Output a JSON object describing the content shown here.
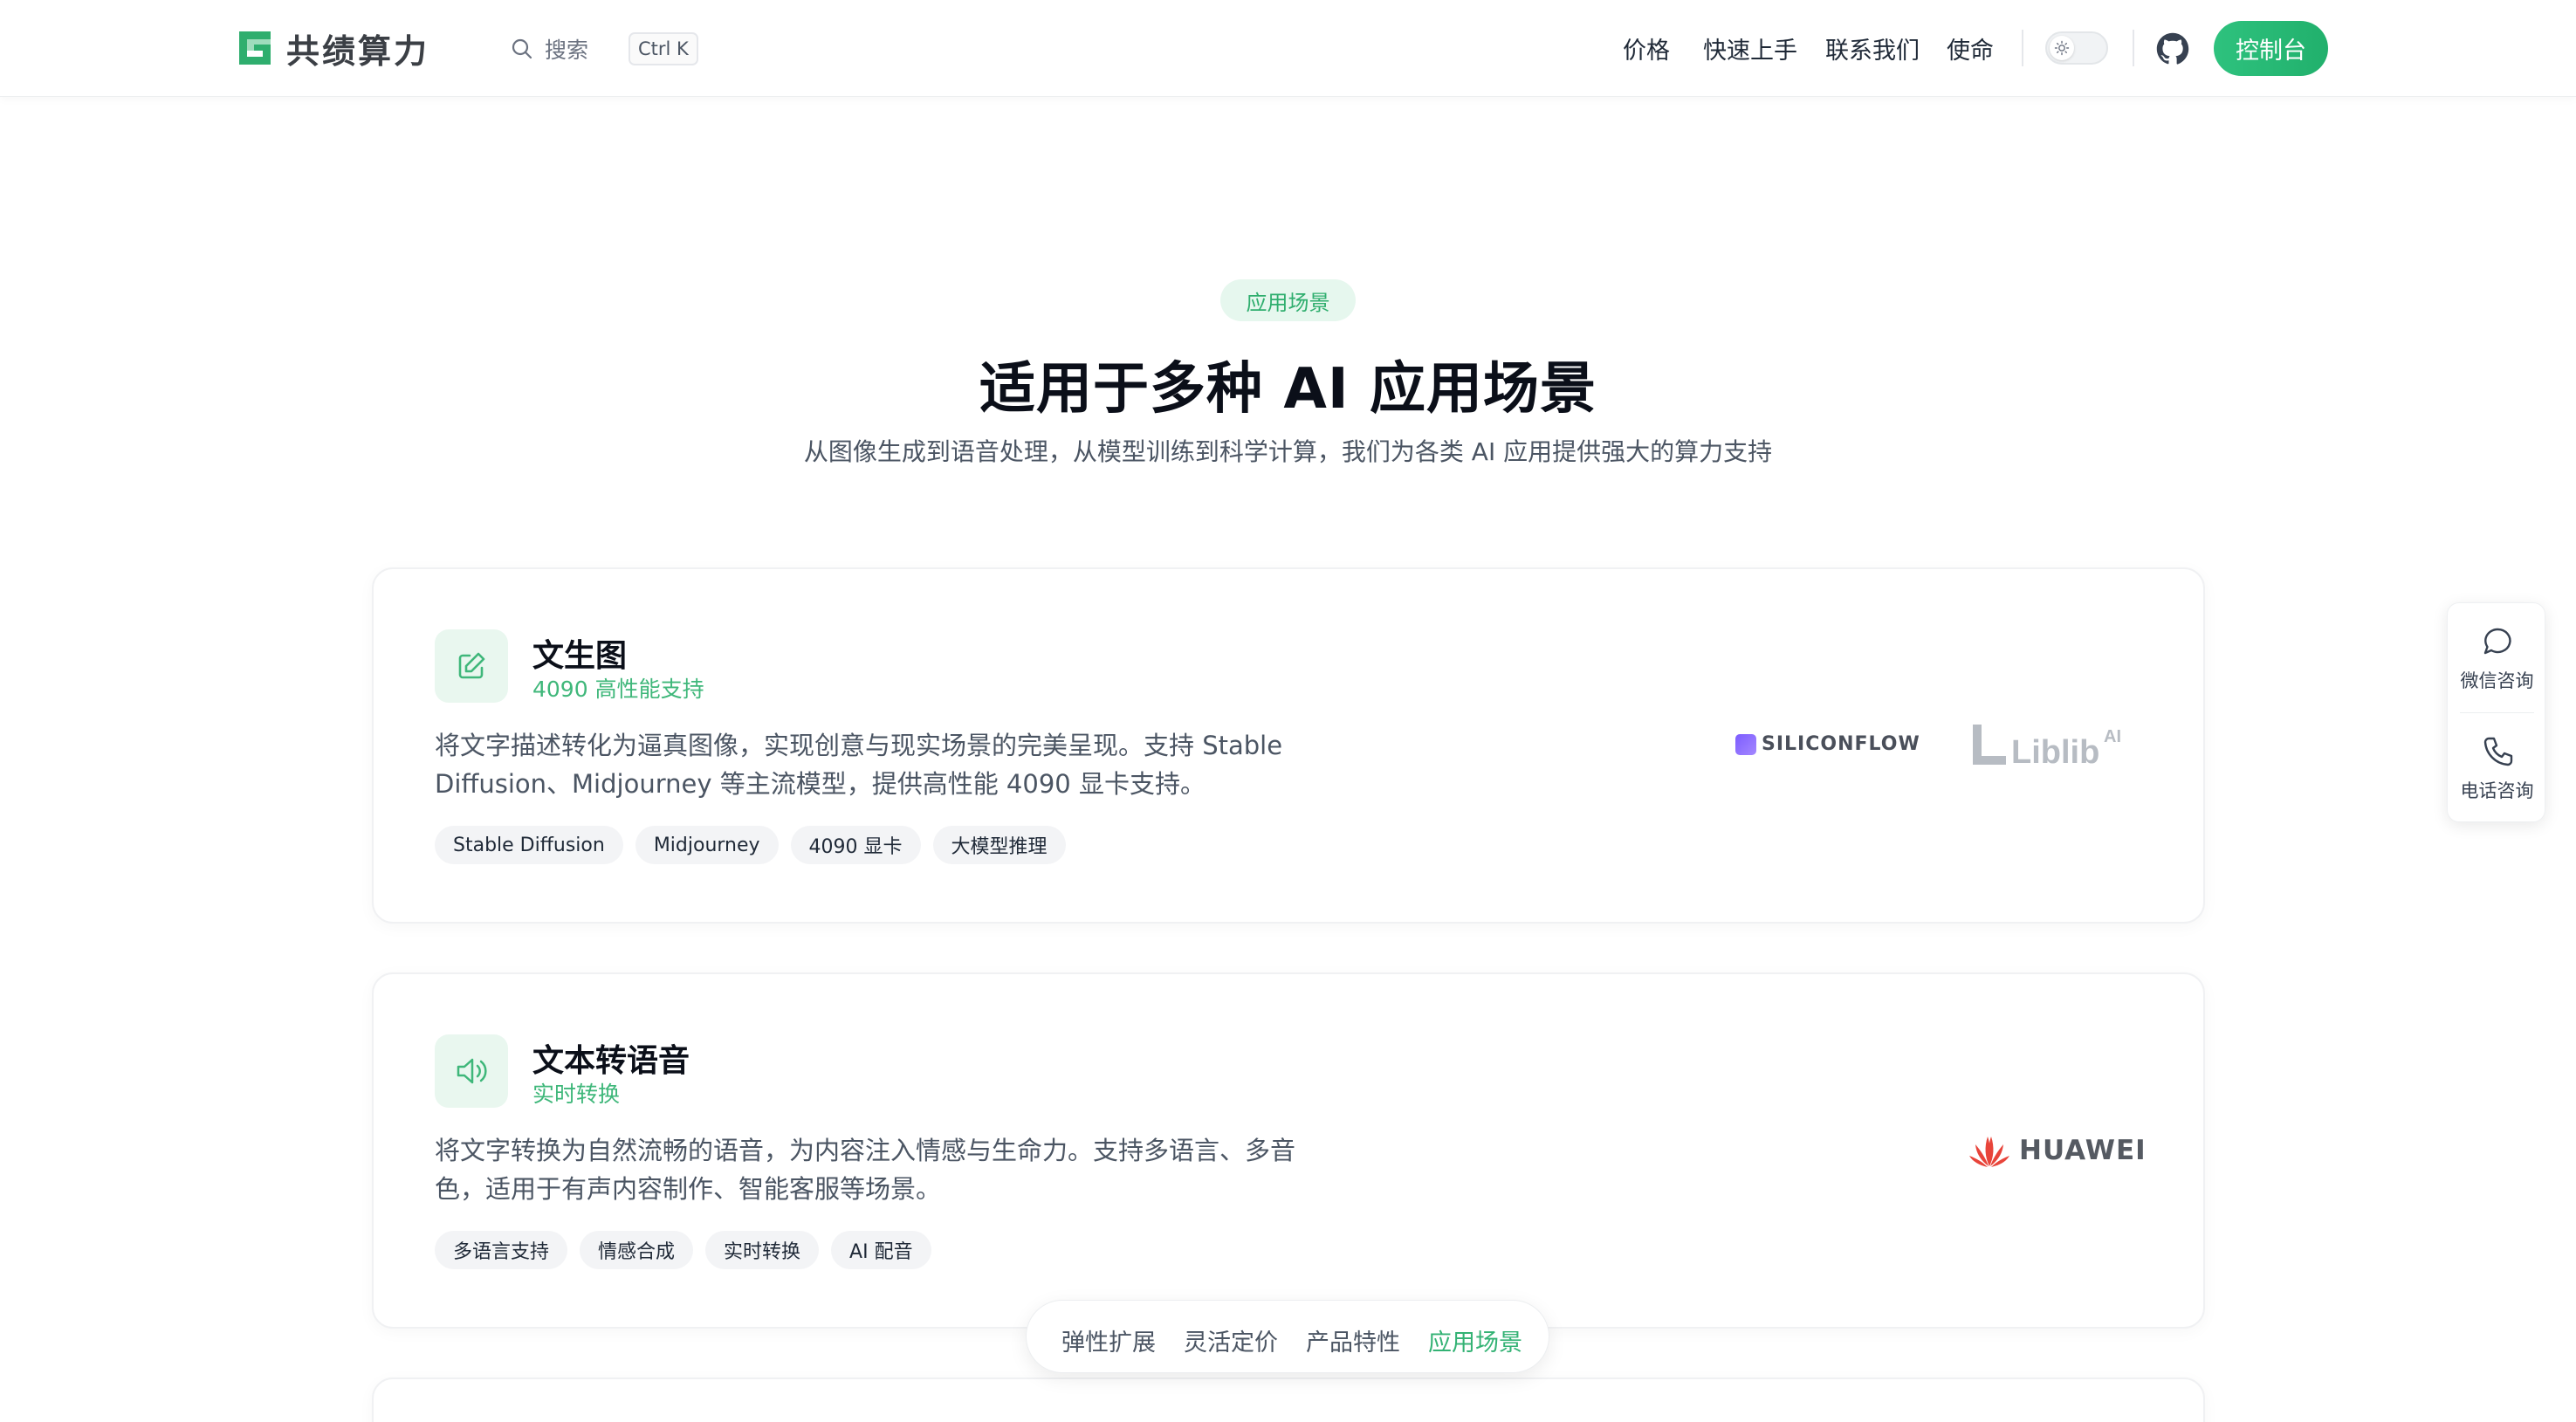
{
  "header": {
    "brand": "共绩算力",
    "search_label": "搜索",
    "search_shortcut": "Ctrl K",
    "nav": [
      "价格",
      "快速上手",
      "联系我们",
      "使命"
    ],
    "console_button": "控制台"
  },
  "section": {
    "badge": "应用场景",
    "title": "适用于多种 AI 应用场景",
    "subtitle": "从图像生成到语音处理，从模型训练到科学计算，我们为各类 AI 应用提供强大的算力支持"
  },
  "cards": [
    {
      "icon": "edit-icon",
      "title": "文生图",
      "subtitle": "4090 高性能支持",
      "description": "将文字描述转化为逼真图像，实现创意与现实场景的完美呈现。支持 Stable Diffusion、Midjourney 等主流模型，提供高性能 4090 显卡支持。",
      "tags": [
        "Stable Diffusion",
        "Midjourney",
        "4090 显卡",
        "大模型推理"
      ],
      "partners": [
        "SILICONFLOW",
        "LiblibAI"
      ]
    },
    {
      "icon": "speaker-icon",
      "title": "文本转语音",
      "subtitle": "实时转换",
      "description": "将文字转换为自然流畅的语音，为内容注入情感与生命力。支持多语言、多音色，适用于有声内容制作、智能客服等场景。",
      "tags": [
        "多语言支持",
        "情感合成",
        "实时转换",
        "AI 配音"
      ],
      "partners": [
        "HUAWEI"
      ]
    }
  ],
  "side_panel": {
    "items": [
      {
        "icon": "chat-bubble-icon",
        "label": "微信咨询"
      },
      {
        "icon": "phone-icon",
        "label": "电话咨询"
      }
    ]
  },
  "float_nav": {
    "items": [
      "弹性扩展",
      "灵活定价",
      "产品特性",
      "应用场景"
    ],
    "active": "应用场景"
  },
  "colors": {
    "accent": "#2ec27e",
    "accent_text": "#33b274",
    "badge_bg": "#e6f7ee"
  }
}
